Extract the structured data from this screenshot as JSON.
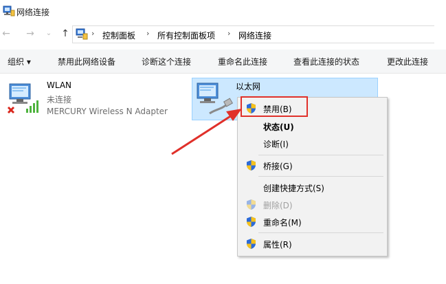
{
  "window": {
    "title": "网络连接"
  },
  "address": {
    "crumbs": [
      "控制面板",
      "所有控制面板项",
      "网络连接"
    ]
  },
  "toolbar": {
    "items": [
      "组织 ▾",
      "禁用此网络设备",
      "诊断这个连接",
      "重命名此连接",
      "查看此连接的状态",
      "更改此连接"
    ]
  },
  "connections": [
    {
      "name": "WLAN",
      "status": "未连接",
      "adapter": "MERCURY Wireless N Adapter"
    },
    {
      "name": "以太网",
      "status": "",
      "adapter": ""
    }
  ],
  "context_menu": {
    "items": [
      {
        "label": "禁用(B)",
        "shield": true,
        "bold": false,
        "disabled": false
      },
      {
        "label": "状态(U)",
        "shield": false,
        "bold": true,
        "disabled": false
      },
      {
        "label": "诊断(I)",
        "shield": false,
        "bold": false,
        "disabled": false
      },
      {
        "label": "桥接(G)",
        "shield": true,
        "bold": false,
        "disabled": false
      },
      {
        "label": "创建快捷方式(S)",
        "shield": false,
        "bold": false,
        "disabled": false
      },
      {
        "label": "删除(D)",
        "shield": true,
        "bold": false,
        "disabled": true
      },
      {
        "label": "重命名(M)",
        "shield": true,
        "bold": false,
        "disabled": false
      },
      {
        "label": "属性(R)",
        "shield": true,
        "bold": false,
        "disabled": false
      }
    ]
  },
  "colors": {
    "selection": "#cce8ff",
    "annotation_red": "#e0302a",
    "menu_bg": "#f2f2f2",
    "toolbar_bg": "#f5f6f7"
  },
  "icons": {
    "app": "network-connections-icon",
    "wlan": "wireless-adapter-icon",
    "ethernet": "ethernet-adapter-icon",
    "shield": "uac-shield-icon"
  }
}
